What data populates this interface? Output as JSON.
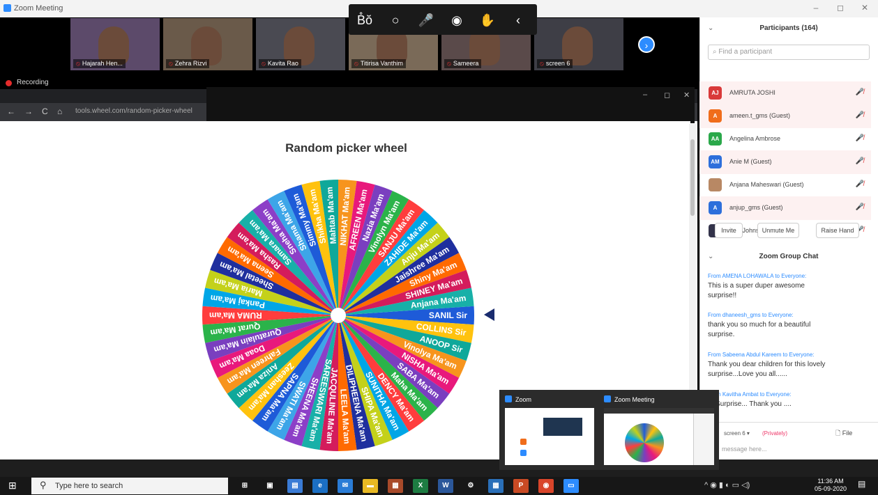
{
  "window": {
    "title": "Zoom Meeting"
  },
  "gallery": {
    "tiles": [
      {
        "label": "Hajarah Hen...",
        "color": "#5c4a6a"
      },
      {
        "label": "Zehra Rizvi",
        "color": "#6a5a4a"
      },
      {
        "label": "Kavita Rao",
        "color": "#4a4a52"
      },
      {
        "label": "Titirisa Vanthim",
        "color": "#7a6a58"
      },
      {
        "label": "Sameera",
        "color": "#5a4a4a"
      },
      {
        "label": "screen 6",
        "color": "#3e3e46"
      }
    ],
    "next_label": "›"
  },
  "annotation_toolbar": {
    "items": [
      "B̊ŏ",
      "○",
      "🎤",
      "◉",
      "✋",
      "‹"
    ]
  },
  "recording": {
    "label": "Recording"
  },
  "browser": {
    "nav": [
      "←",
      "→",
      "C",
      "⌂"
    ],
    "url": "tools.wheel.com/random-picker-wheel"
  },
  "share_overlay_controls": [
    "–",
    "◻",
    "✕"
  ],
  "wheel": {
    "title": "Random picker wheel",
    "names": [
      "SANIL Sir",
      "COLLINS Sir",
      "ANOOP Sir",
      "Vinolya Ma'am",
      "NISHA Ma'am",
      "SABA Ma'am",
      "Maha Ma'am",
      "DENCY Ma'am",
      "SUNITHA Ma'am",
      "SHIPA Ma'am",
      "DILIPHEENA Ma'am",
      "LEELA Ma'am",
      "JACQULINE Ma'am",
      "SAREESWARI Ma'am",
      "SHEENA Ma'am",
      "SWATI Ma'am",
      "SAPNA Ma'am",
      "Zeeshan Ma'am",
      "Aniza Ma'am",
      "Fahreen Ma'am",
      "Doaa Ma'am",
      "Quratulain Ma'am",
      "Qurat Ma'am",
      "RUMA Ma'am",
      "Pankaj Ma'am",
      "Maria Ma'am",
      "Sheetal Ma'am",
      "Seena Ma'am",
      "Rasha Ma'am",
      "Samara Ma'am",
      "Sneha Ma'am",
      "Shama Ma'am",
      "Simmy Ma'am",
      "Shikha Ma'am",
      "Mahtab Ma'am",
      "NIKHAT Ma'am",
      "AFREEN Ma'am",
      "Nazia Ma'am",
      "Vinolyn Ma'am",
      "SANJU Ma'am",
      "ZAHIDE Ma'am",
      "Anju Ma'am",
      "Jaishree Ma'am",
      "Shiny Ma'am",
      "SHINEY Ma'am",
      "Anjana Ma'am"
    ],
    "colors": [
      "#1e5bd8",
      "#ffc20e",
      "#0fa89a",
      "#f7941d",
      "#e8197c",
      "#7a3fbf",
      "#2bb34a",
      "#ff3d3d",
      "#00a6e6",
      "#c4d11a",
      "#1f2f9e",
      "#ff6a00",
      "#d41c5c",
      "#18b0a8",
      "#8c3fc7",
      "#3da5e8"
    ]
  },
  "participants": {
    "header": "Participants (164)",
    "collapse": "⌄",
    "search_placeholder": "Find a participant",
    "list": [
      {
        "initials": "AJ",
        "name": "AMRUTA JOSHI",
        "color": "#d93a3a"
      },
      {
        "initials": "A",
        "name": "ameen.t_gms (Guest)",
        "color": "#f06d1b"
      },
      {
        "initials": "AA",
        "name": "Angelina Ambrose",
        "color": "#2aa84a"
      },
      {
        "initials": "AM",
        "name": "Anie M (Guest)",
        "color": "#2d6fdb"
      },
      {
        "initials": "",
        "name": "Anjana Maheswari (Guest)",
        "color": "#b88864"
      },
      {
        "initials": "A",
        "name": "anjup_gms (Guest)",
        "color": "#2d6fdb"
      },
      {
        "initials": "",
        "name": "Ann Johnson",
        "color": "#33334a"
      }
    ],
    "mic_icon": "🎤̸",
    "buttons": [
      "Invite",
      "Unmute Me",
      "Raise Hand"
    ]
  },
  "chat": {
    "header": "Zoom Group Chat",
    "collapse": "⌄",
    "messages": [
      {
        "from": "From AMENA LOHAWALA to Everyone:",
        "text": "This is a super duper awesome surprise!!"
      },
      {
        "from": "From dhaneesh_gms to Everyone:",
        "text": "thank you so much for a beautiful surprise."
      },
      {
        "from": "From Sabeena Abdul Kareem to Everyone:",
        "text": "Thank you dear children for this lovely surprise...Love you all......"
      },
      {
        "from": "From Kavitha Ambat to Everyone:",
        "text": "at Surprise... Thank you ...."
      }
    ],
    "to": "screen 6 ▾",
    "privately": "(Privately)",
    "file": "File",
    "input_placeholder": "message here..."
  },
  "previews": [
    {
      "title": "Zoom"
    },
    {
      "title": "Zoom Meeting"
    }
  ],
  "taskbar": {
    "search_placeholder": "Type here to search",
    "apps": [
      {
        "label": "⊞",
        "color": "#171717"
      },
      {
        "label": "▣",
        "color": "#171717"
      },
      {
        "label": "▤",
        "color": "#3a7bd5"
      },
      {
        "label": "e",
        "color": "#1b6fc4"
      },
      {
        "label": "✉",
        "color": "#2a7cd6"
      },
      {
        "label": "▬",
        "color": "#e8b923"
      },
      {
        "label": "▦",
        "color": "#a84a2a"
      },
      {
        "label": "X",
        "color": "#1d7c42"
      },
      {
        "label": "W",
        "color": "#2b579a"
      },
      {
        "label": "⚙",
        "color": "#171717"
      },
      {
        "label": "▦",
        "color": "#2a6fb8"
      },
      {
        "label": "P",
        "color": "#c94a24"
      },
      {
        "label": "◉",
        "color": "#d9452a"
      },
      {
        "label": "▭",
        "color": "#2d8cff"
      }
    ],
    "tray": "^  ◉  ▮  ◐  ▭  ◁)",
    "time": "11:36 AM",
    "date": "05-09-2020"
  }
}
